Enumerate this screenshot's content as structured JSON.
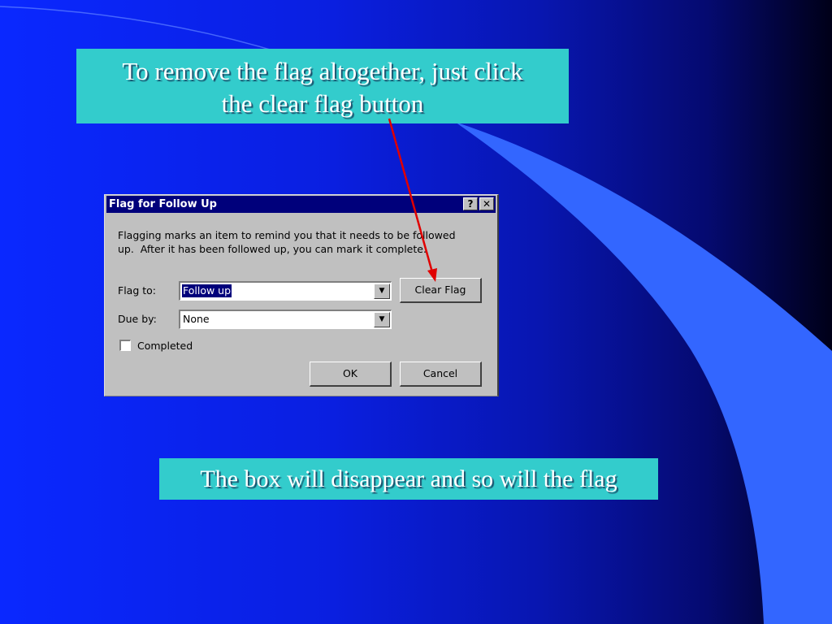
{
  "slide": {
    "top_callout_lines": [
      "To remove the flag altogether, just click",
      "the clear flag button"
    ],
    "bottom_callout": "The box will disappear and so will the flag"
  },
  "dialog": {
    "title": "Flag for Follow Up",
    "help_glyph": "?",
    "close_glyph": "✕",
    "description_lines": [
      "Flagging marks an item to remind you that it needs to be followed",
      "up.  After it has been followed up, you can mark it complete."
    ],
    "flag_to_label": "Flag to:",
    "flag_to_value": "Follow up",
    "due_by_label": "Due by:",
    "due_by_value": "None",
    "completed_label": "Completed",
    "completed_checked": false,
    "clear_flag_button": "Clear Flag",
    "ok_button": "OK",
    "cancel_button": "Cancel",
    "dropdown_glyph": "▼"
  },
  "colors": {
    "callout_bg": "#33cccc",
    "slide_bg": "#0a28ff",
    "decor_light": "#3366ff",
    "arrow": "#e00000",
    "titlebar": "#00007b"
  }
}
